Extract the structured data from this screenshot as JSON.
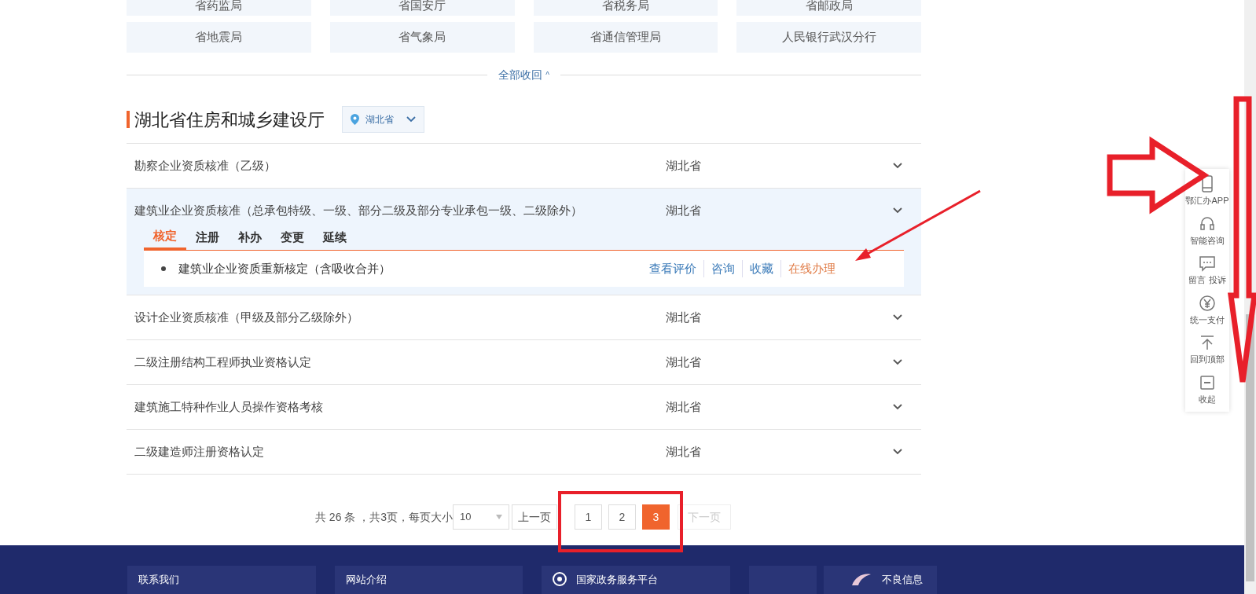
{
  "departments": [
    {
      "label": "省药监局"
    },
    {
      "label": "省国安厅"
    },
    {
      "label": "省税务局"
    },
    {
      "label": "省邮政局"
    },
    {
      "label": "省地震局"
    },
    {
      "label": "省气象局"
    },
    {
      "label": "省通信管理局"
    },
    {
      "label": "人民银行武汉分行"
    }
  ],
  "collapse_link": {
    "label": "全部收回",
    "icon": "^"
  },
  "section": {
    "title": "湖北省住房和城乡建设厅",
    "region_filter": "湖北省"
  },
  "rows": [
    {
      "title": "勘察企业资质核准（乙级）",
      "region": "湖北省",
      "expanded": false
    },
    {
      "title": "建筑业企业资质核准（总承包特级、一级、部分二级及部分专业承包一级、二级除外）",
      "region": "湖北省",
      "expanded": true,
      "tabs": [
        {
          "label": "核定",
          "selected": true
        },
        {
          "label": "注册",
          "selected": false
        },
        {
          "label": "补办",
          "selected": false
        },
        {
          "label": "变更",
          "selected": false
        },
        {
          "label": "延续",
          "selected": false
        }
      ],
      "items": [
        {
          "title": "建筑业企业资质重新核定（含吸收合并）",
          "actions": [
            {
              "label": "查看评价",
              "kind": "link"
            },
            {
              "label": "咨询",
              "kind": "link"
            },
            {
              "label": "收藏",
              "kind": "link"
            },
            {
              "label": "在线办理",
              "kind": "primary"
            }
          ]
        }
      ]
    },
    {
      "title": "设计企业资质核准（甲级及部分乙级除外）",
      "region": "湖北省",
      "expanded": false
    },
    {
      "title": "二级注册结构工程师执业资格认定",
      "region": "湖北省",
      "expanded": false
    },
    {
      "title": "建筑施工特种作业人员操作资格考核",
      "region": "湖北省",
      "expanded": false
    },
    {
      "title": "二级建造师注册资格认定",
      "region": "湖北省",
      "expanded": false
    }
  ],
  "pagination": {
    "summary": "共 26 条 ，共3页，每页大小",
    "page_size": "10",
    "prev": "上一页",
    "next": "下一页",
    "next_disabled": true,
    "pages": [
      {
        "label": "1",
        "selected": false
      },
      {
        "label": "2",
        "selected": false
      },
      {
        "label": "3",
        "selected": true
      }
    ]
  },
  "side_toolbar": [
    {
      "label": "鄂汇办APP",
      "kind": "phone"
    },
    {
      "label": "智能咨询",
      "kind": "headset"
    },
    {
      "label": "留言 投诉",
      "kind": "message"
    },
    {
      "label": "统一支付",
      "kind": "yuan"
    },
    {
      "label": "回到顶部",
      "kind": "top"
    },
    {
      "label": "收起",
      "kind": "collapse"
    }
  ],
  "footer": [
    {
      "label": "联系我们",
      "kind": "text"
    },
    {
      "label": "网站介绍",
      "kind": "text"
    },
    {
      "label": "国家政务服务平台",
      "kind": "emblem"
    },
    {
      "kind": "empty"
    },
    {
      "label": "不良信息",
      "kind": "logo"
    }
  ],
  "annotations": [
    {
      "kind": "thin-arrow"
    },
    {
      "kind": "hollow-arrow-right"
    },
    {
      "kind": "hollow-arrow-down"
    },
    {
      "kind": "frame"
    }
  ]
}
